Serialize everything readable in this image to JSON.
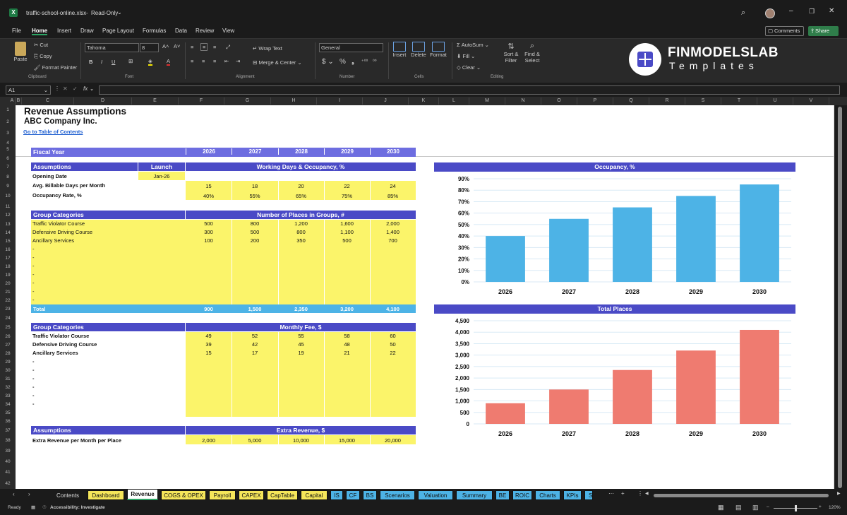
{
  "titlebar": {
    "filename": "traffic-school-online.xlsx",
    "mode": "Read-Only"
  },
  "menu": [
    "File",
    "Home",
    "Insert",
    "Draw",
    "Page Layout",
    "Formulas",
    "Data",
    "Review",
    "View"
  ],
  "comments_label": "Comments",
  "share_label": "Share",
  "ribbon": {
    "cut": "Cut",
    "copy": "Copy",
    "paste": "Paste",
    "format_painter": "Format Painter",
    "clipboard": "Clipboard",
    "font_name": "Tahoma",
    "font_size": "8",
    "font": "Font",
    "wrap_text": "Wrap Text",
    "merge_center": "Merge & Center",
    "alignment": "Alignment",
    "number_format": "General",
    "number": "Number",
    "insert": "Insert",
    "delete": "Delete",
    "format": "Format",
    "cells": "Cells",
    "autosum": "AutoSum",
    "fill": "Fill",
    "clear": "Clear",
    "sort_filter": "Sort & Filter",
    "find_select": "Find & Select",
    "editing": "Editing",
    "brand_line1": "FINMODELSLAB",
    "brand_line2": "Templates"
  },
  "namebox": "A1",
  "columns": [
    "A",
    "B",
    "C",
    "D",
    "E",
    "F",
    "G",
    "H",
    "I",
    "J",
    "K",
    "L",
    "M",
    "N",
    "O",
    "P",
    "Q",
    "R",
    "S",
    "T",
    "U",
    "V"
  ],
  "rows": [
    "1",
    "2",
    "3",
    "4",
    "5",
    "6",
    "7",
    "8",
    "9",
    "10",
    "11",
    "12",
    "13",
    "14",
    "15",
    "16",
    "17",
    "18",
    "19",
    "20",
    "21",
    "22",
    "23",
    "24",
    "25",
    "26",
    "27",
    "28",
    "29",
    "30",
    "31",
    "32",
    "33",
    "34",
    "35",
    "36",
    "37",
    "38",
    "39",
    "40",
    "41",
    "42"
  ],
  "sheet": {
    "title": "Revenue Assumptions",
    "company": "ABC Company Inc.",
    "toc_link": "Go to Table of Contents",
    "fiscal_year": "Fiscal Year",
    "years": [
      "2026",
      "2027",
      "2028",
      "2029",
      "2030"
    ],
    "assumptions": "Assumptions",
    "launch": "Launch",
    "wdo_header": "Working Days & Occupancy, %",
    "opening_date": "Opening Date",
    "opening_date_value": "Jan-26",
    "billable_days": "Avg. Billable Days per Month",
    "billable_values": [
      "15",
      "18",
      "20",
      "22",
      "24"
    ],
    "occupancy_rate": "Occupancy Rate, %",
    "occupancy_values": [
      "40%",
      "55%",
      "65%",
      "75%",
      "85%"
    ],
    "group_categories": "Group Categories",
    "places_header": "Number of Places in Groups, #",
    "places_rows": [
      {
        "name": "Traffic Violator Course",
        "values": [
          "500",
          "800",
          "1,200",
          "1,600",
          "2,000"
        ]
      },
      {
        "name": "Defensive Driving Course",
        "values": [
          "300",
          "500",
          "800",
          "1,100",
          "1,400"
        ]
      },
      {
        "name": "Ancillary Services",
        "values": [
          "100",
          "200",
          "350",
          "500",
          "700"
        ]
      }
    ],
    "dash": "-",
    "total": "Total",
    "total_values": [
      "900",
      "1,500",
      "2,350",
      "3,200",
      "4,100"
    ],
    "fee_header": "Monthly Fee, $",
    "fee_rows": [
      {
        "name": "Traffic Violator Course",
        "values": [
          "49",
          "52",
          "55",
          "58",
          "60"
        ]
      },
      {
        "name": "Defensive Driving Course",
        "values": [
          "39",
          "42",
          "45",
          "48",
          "50"
        ]
      },
      {
        "name": "Ancillary Services",
        "values": [
          "15",
          "17",
          "19",
          "21",
          "22"
        ]
      }
    ],
    "extra_header": "Extra Revenue, $",
    "extra_label": "Extra Revenue per Month per Place",
    "extra_values": [
      "2,000",
      "5,000",
      "10,000",
      "15,000",
      "20,000"
    ]
  },
  "chart_data": [
    {
      "type": "bar",
      "title": "Occupancy, %",
      "categories": [
        "2026",
        "2027",
        "2028",
        "2029",
        "2030"
      ],
      "values": [
        40,
        55,
        65,
        75,
        85
      ],
      "ylim": [
        0,
        90
      ],
      "yticks": [
        "0%",
        "10%",
        "20%",
        "30%",
        "40%",
        "50%",
        "60%",
        "70%",
        "80%",
        "90%"
      ],
      "color": "#4db3e6"
    },
    {
      "type": "bar",
      "title": "Total Places",
      "categories": [
        "2026",
        "2027",
        "2028",
        "2029",
        "2030"
      ],
      "values": [
        900,
        1500,
        2350,
        3200,
        4100
      ],
      "ylim": [
        0,
        4500
      ],
      "yticks": [
        "0",
        "500",
        "1,000",
        "1,500",
        "2,000",
        "2,500",
        "3,000",
        "3,500",
        "4,000",
        "4,500"
      ],
      "color": "#ef7b70"
    }
  ],
  "tabs": [
    "Contents",
    "Dashboard",
    "Revenue",
    "COGS & OPEX",
    "Payroll",
    "CAPEX",
    "CapTable",
    "Capital",
    "IS",
    "CF",
    "BS",
    "Scenarios",
    "Valuation",
    "Summary",
    "BE",
    "ROIC",
    "Charts",
    "KPIs"
  ],
  "status": {
    "ready": "Ready",
    "accessibility": "Accessibility: Investigate",
    "zoom": "120%"
  }
}
